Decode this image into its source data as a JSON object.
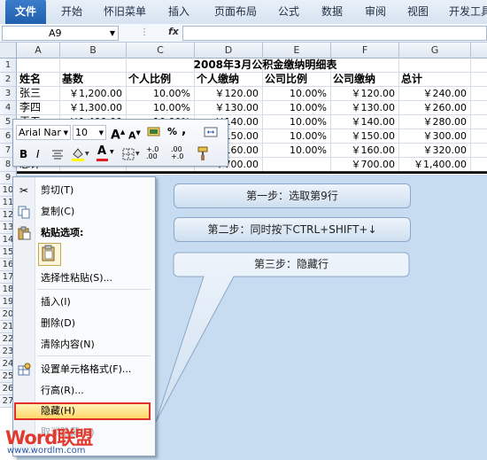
{
  "ribbon": {
    "tabs": [
      "文件",
      "开始",
      "怀旧菜单",
      "插入",
      "页面布局",
      "公式",
      "数据",
      "审阅",
      "视图",
      "开发工具"
    ]
  },
  "formula_bar": {
    "name_box": "A9",
    "fx": "fx",
    "content": ""
  },
  "columns": [
    "A",
    "B",
    "C",
    "D",
    "E",
    "F",
    "G"
  ],
  "rows": [
    "1",
    "2",
    "3",
    "4",
    "5",
    "6",
    "7",
    "8",
    "9",
    "10",
    "11",
    "12",
    "13",
    "14",
    "15",
    "16",
    "17",
    "18",
    "19",
    "20",
    "21",
    "22",
    "23",
    "24",
    "25",
    "26",
    "27"
  ],
  "sheet": {
    "title": "2008年3月公积金缴纳明细表",
    "headers": [
      "姓名",
      "基数",
      "个人比例",
      "个人缴纳",
      "公司比例",
      "公司缴纳",
      "总计"
    ],
    "data": [
      [
        "张三",
        "￥1,200.00",
        "10.00%",
        "￥120.00",
        "10.00%",
        "￥120.00",
        "￥240.00"
      ],
      [
        "李四",
        "￥1,300.00",
        "10.00%",
        "￥130.00",
        "10.00%",
        "￥130.00",
        "￥260.00"
      ],
      [
        "王五",
        "￥1,400.00",
        "10.00%",
        "￥140.00",
        "10.00%",
        "￥140.00",
        "￥280.00"
      ],
      [
        "",
        "",
        "",
        "￥150.00",
        "10.00%",
        "￥150.00",
        "￥300.00"
      ],
      [
        "",
        "",
        "",
        "￥160.00",
        "10.00%",
        "￥160.00",
        "￥320.00"
      ],
      [
        "总计",
        "",
        "",
        "￥700.00",
        "",
        "￥700.00",
        "￥1,400.00"
      ]
    ]
  },
  "mini_toolbar": {
    "font_name": "Arial Nar",
    "font_size": "10",
    "grow_font": "A",
    "shrink_font": "A",
    "percent": "%",
    "comma": ",",
    "bold": "B",
    "italic": "I",
    "font_color": "A",
    "increase_decimal": "+.0 .00",
    "decrease_decimal": ".00 +.0"
  },
  "context_menu": {
    "cut": "剪切(T)",
    "copy": "复制(C)",
    "paste_options": "粘贴选项:",
    "paste_special": "选择性粘贴(S)...",
    "insert": "插入(I)",
    "delete": "删除(D)",
    "clear_contents": "清除内容(N)",
    "format_cells": "设置单元格格式(F)...",
    "row_height": "行高(R)...",
    "hide": "隐藏(H)",
    "unhide": "取消隐藏(U)"
  },
  "callouts": {
    "step1": "第一步：选取第9行",
    "step2": "第二步：同时按下CTRL+SHIFT+↓",
    "step3": "第三步：隐藏行"
  },
  "watermark": {
    "brand": "Word联盟",
    "url": "www.wordlm.com"
  },
  "colors": {
    "hidden_area": "#c7dcf1",
    "highlight_border": "#e0302a",
    "file_tab": "#2a6bbd"
  }
}
